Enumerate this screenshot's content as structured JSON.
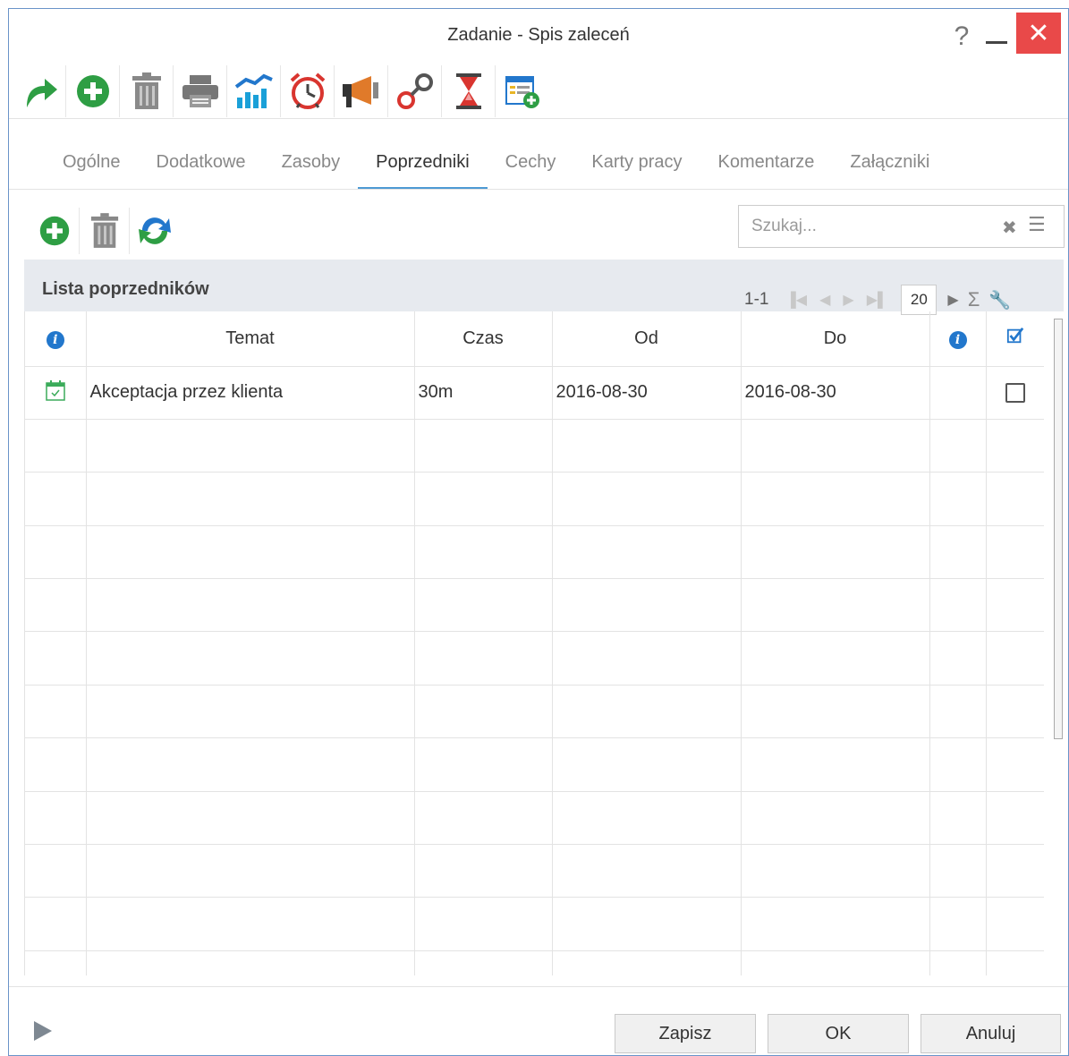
{
  "window": {
    "title": "Zadanie - Spis zaleceń",
    "help": "?",
    "close": "✕"
  },
  "toolbar": {
    "items": [
      {
        "icon": "forward-arrow-icon"
      },
      {
        "icon": "add-icon"
      },
      {
        "icon": "trash-icon"
      },
      {
        "icon": "printer-icon"
      },
      {
        "icon": "chart-icon"
      },
      {
        "icon": "alarm-clock-icon"
      },
      {
        "icon": "megaphone-icon"
      },
      {
        "icon": "link-icon"
      },
      {
        "icon": "hourglass-icon"
      },
      {
        "icon": "form-add-icon"
      }
    ]
  },
  "tabs": [
    {
      "label": "Ogólne",
      "active": false
    },
    {
      "label": "Dodatkowe",
      "active": false
    },
    {
      "label": "Zasoby",
      "active": false
    },
    {
      "label": "Poprzedniki",
      "active": true
    },
    {
      "label": "Cechy",
      "active": false
    },
    {
      "label": "Karty pracy",
      "active": false
    },
    {
      "label": "Komentarze",
      "active": false
    },
    {
      "label": "Załączniki",
      "active": false
    }
  ],
  "search": {
    "placeholder": "Szukaj..."
  },
  "panel": {
    "title": "Lista poprzedników",
    "pager": {
      "range": "1-1",
      "page_size": "20"
    }
  },
  "grid": {
    "columns": [
      "",
      "Temat",
      "Czas",
      "Od",
      "Do",
      "",
      ""
    ],
    "rows": [
      {
        "icon": "task-calendar-icon",
        "temat": "Akceptacja przez klienta",
        "czas": "30m",
        "od": "2016-08-30",
        "do": "2016-08-30",
        "checked": false
      }
    ]
  },
  "footer": {
    "save": "Zapisz",
    "ok": "OK",
    "cancel": "Anuluj"
  },
  "colors": {
    "accent": "#4e9ad4",
    "close": "#e94949",
    "green": "#2e9e44",
    "blue_info": "#2277cc"
  }
}
